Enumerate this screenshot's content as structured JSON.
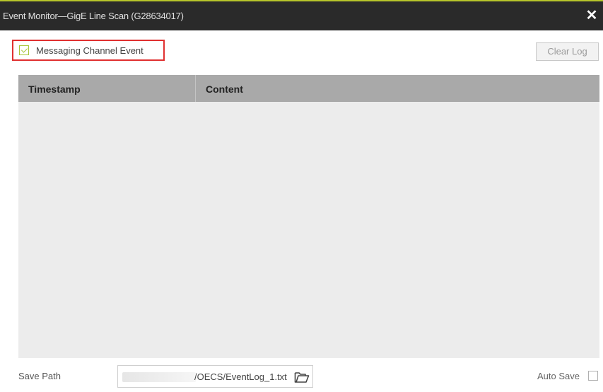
{
  "window": {
    "title": "Event Monitor—GigE Line Scan (G28634017)",
    "close_icon": "close-icon",
    "accent_color": "#b7c52a"
  },
  "controls": {
    "messaging_channel_event": {
      "label": "Messaging Channel Event",
      "checked": true
    },
    "clear_log_label": "Clear Log"
  },
  "table": {
    "columns": [
      "Timestamp",
      "Content"
    ],
    "rows": []
  },
  "footer": {
    "save_path_label": "Save Path",
    "save_path_value": "/OECS/EventLog_1.txt",
    "folder_icon": "folder-open-icon",
    "auto_save_label": "Auto Save",
    "auto_save_checked": false
  }
}
